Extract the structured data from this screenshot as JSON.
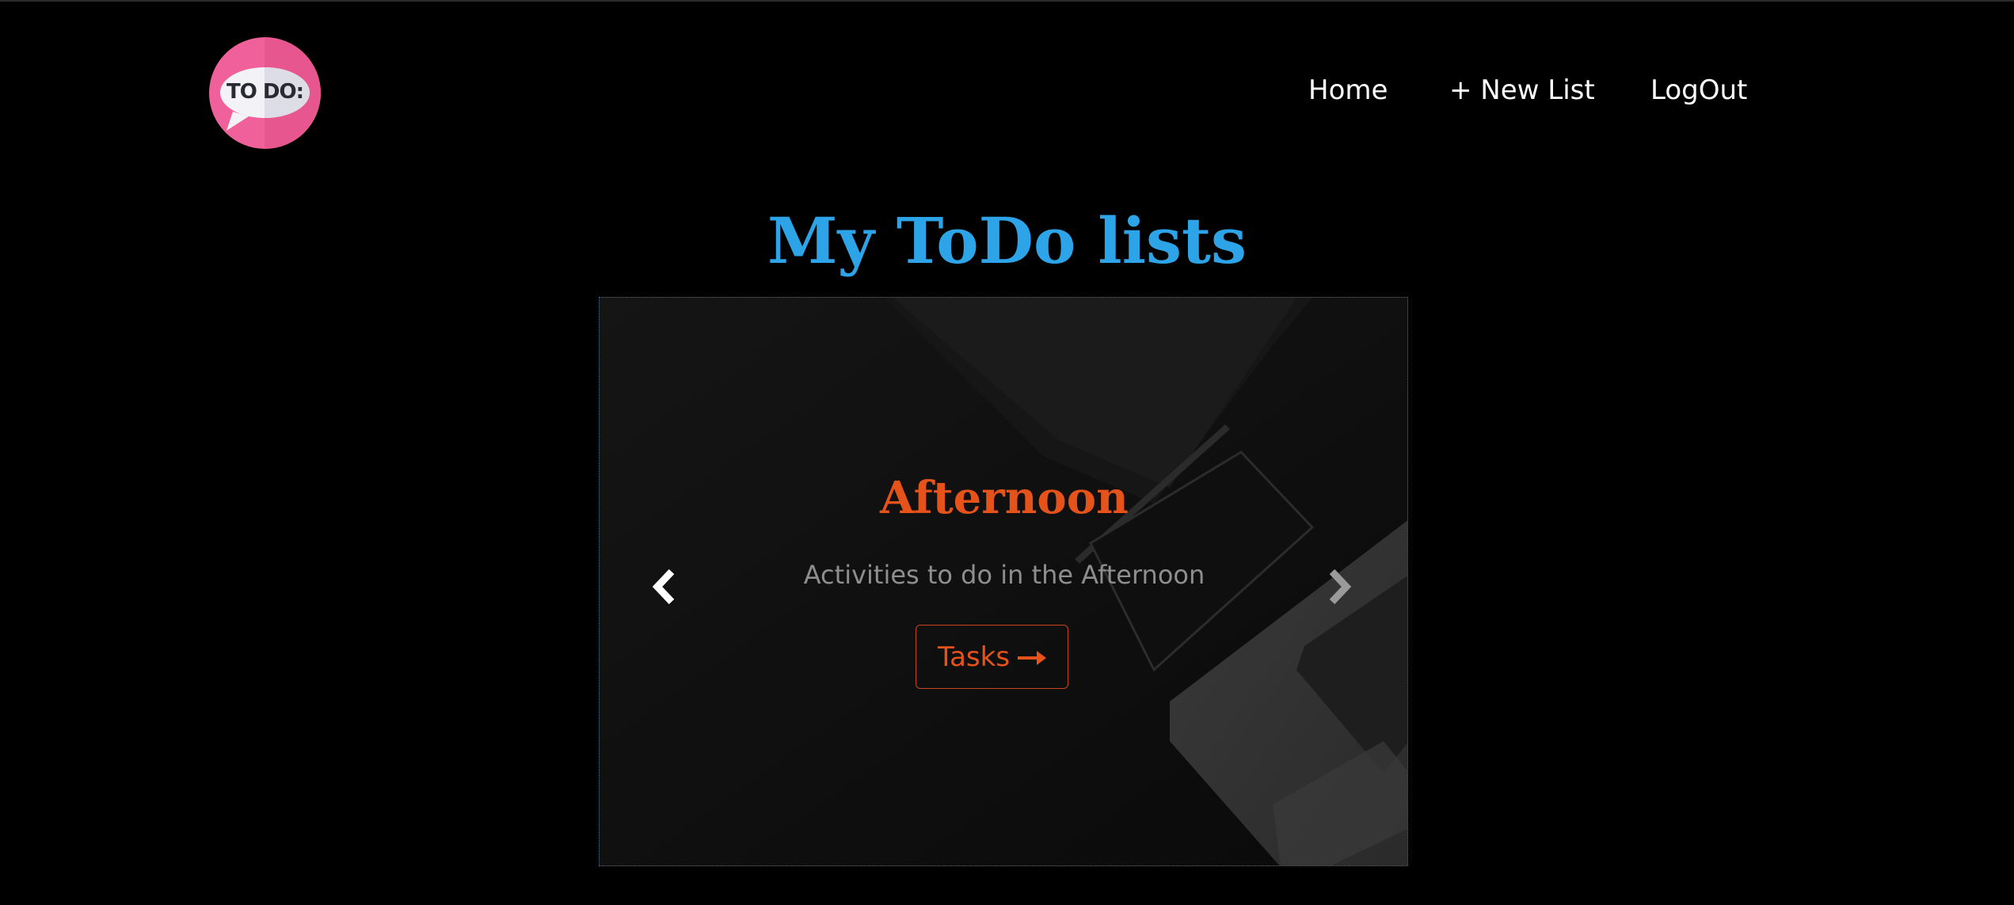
{
  "logo": {
    "text": "TO DO:",
    "icon": "todo-speech-bubble-logo"
  },
  "nav": {
    "items": [
      {
        "label": "Home"
      },
      {
        "label": "+ New List"
      },
      {
        "label": "LogOut"
      }
    ]
  },
  "main": {
    "title": "My ToDo lists"
  },
  "carousel": {
    "slide": {
      "title": "Afternoon",
      "description": "Activities to do in the Afternoon",
      "button_label": "Tasks",
      "button_icon": "right-arrow-icon"
    },
    "prev_icon": "chevron-left-icon",
    "next_icon": "chevron-right-icon"
  },
  "colors": {
    "background": "#000000",
    "title_blue": "#2ea4e8",
    "accent_orange": "#e5531b",
    "logo_pink": "#f0609a",
    "nav_text": "#ffffff"
  }
}
